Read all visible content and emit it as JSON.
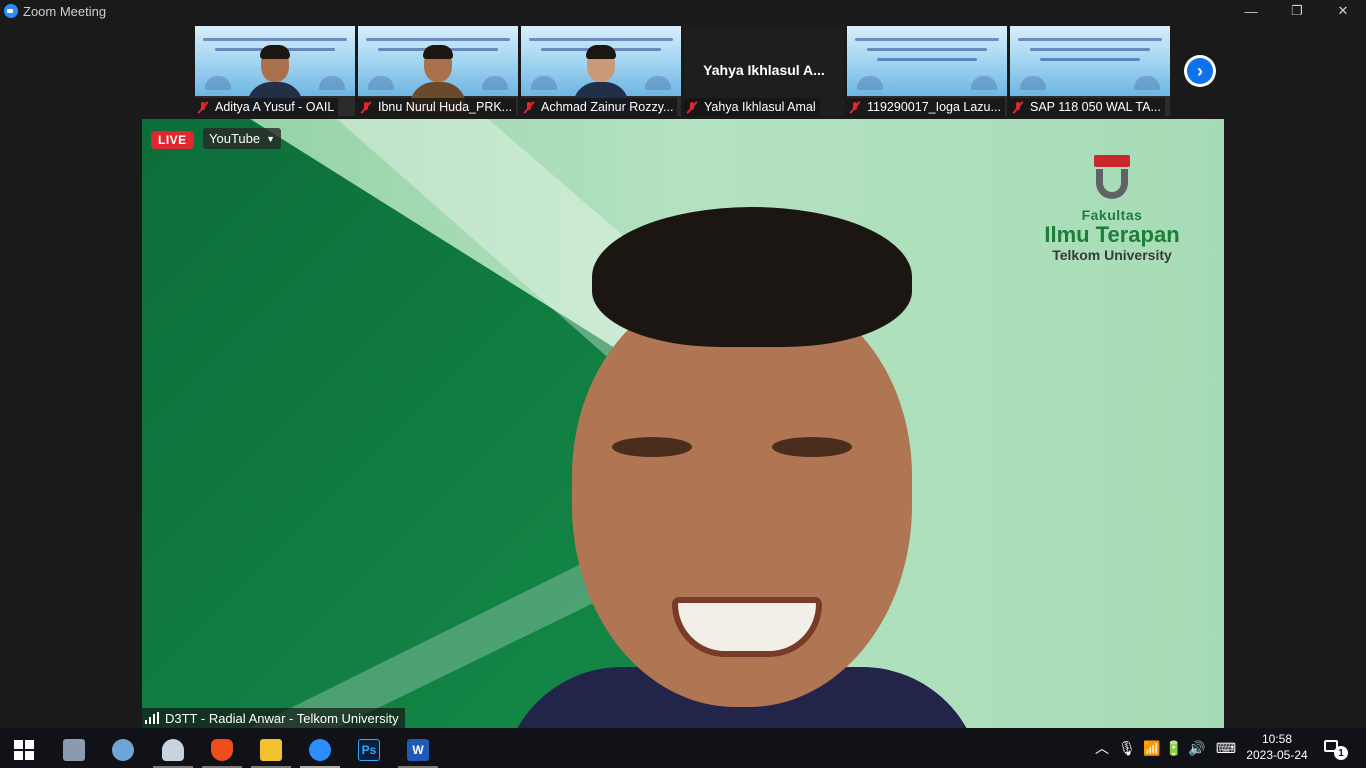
{
  "window": {
    "title": "Zoom Meeting",
    "controls": {
      "minimize": "—",
      "restore": "❐",
      "close": "✕"
    }
  },
  "participants": [
    {
      "name": "Aditya A Yusuf - OAIL",
      "muted": true,
      "video": true
    },
    {
      "name": "Ibnu Nurul Huda_PRK...",
      "muted": true,
      "video": true
    },
    {
      "name": "Achmad Zainur Rozzy...",
      "muted": true,
      "video": true
    },
    {
      "name": "Yahya Ikhlasul Amal",
      "display_name": "Yahya Ikhlasul A...",
      "muted": true,
      "video": false
    },
    {
      "name": "119290017_Ioga Lazu...",
      "muted": true,
      "video": false
    },
    {
      "name": "SAP 118 050 WAL TA...",
      "muted": true,
      "video": false
    }
  ],
  "next_page_icon": "chevron-right-icon",
  "main": {
    "live_badge": "LIVE",
    "stream_platform": "YouTube",
    "speaker_name": "D3TT - Radial Anwar - Telkom University",
    "logo": {
      "line1": "Fakultas",
      "line2": "Ilmu Terapan",
      "line3": "Telkom University"
    }
  },
  "taskbar": {
    "apps": [
      "start-icon",
      "calculator-icon",
      "paint-icon",
      "network-drive-icon",
      "brave-icon",
      "file-explorer-icon",
      "zoom-icon",
      "photoshop-icon",
      "word-icon"
    ],
    "photoshop_label": "Ps",
    "word_label": "W",
    "time": "10:58",
    "date": "2023-05-24",
    "notifications": "1"
  },
  "colors": {
    "zoom_blue": "#2d8cff",
    "live_red": "#e0272e",
    "muted_red": "#e02828",
    "brand_green": "#1f7d3a"
  }
}
